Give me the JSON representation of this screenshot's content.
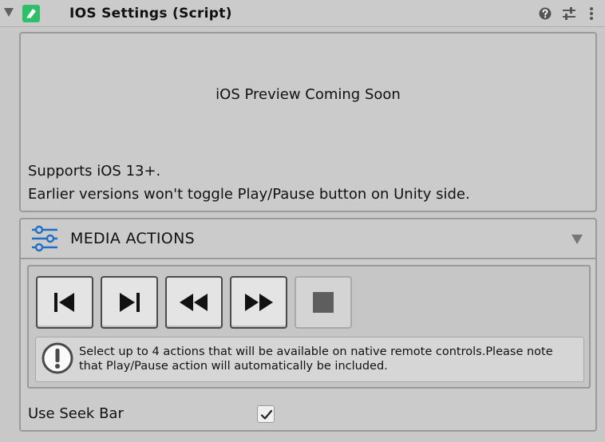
{
  "component": {
    "title": "IOS Settings (Script)",
    "icons": [
      "foldout-arrow-icon",
      "script-icon",
      "help-icon",
      "preset-icon",
      "kebab-menu-icon"
    ]
  },
  "preview": {
    "title": "iOS Preview Coming Soon",
    "support_text": "Supports iOS 13+.",
    "earlier_text": "Earlier versions won't toggle Play/Pause button on Unity side."
  },
  "media_actions": {
    "title": "MEDIA ACTIONS",
    "buttons": [
      {
        "name": "previous-track",
        "icon": "skip-previous-icon",
        "enabled": true
      },
      {
        "name": "next-track",
        "icon": "skip-next-icon",
        "enabled": true
      },
      {
        "name": "rewind",
        "icon": "rewind-icon",
        "enabled": true
      },
      {
        "name": "fast-forward",
        "icon": "fast-forward-icon",
        "enabled": true
      },
      {
        "name": "stop",
        "icon": "stop-icon",
        "enabled": false
      }
    ],
    "help_text": "Select up to 4 actions that will be available on native remote controls.Please note that Play/Pause action will automatically be included."
  },
  "seek_bar": {
    "label": "Use Seek Bar",
    "checked": true
  },
  "colors": {
    "background": "#c8c8c8",
    "accent_blue": "#1f6fc5",
    "script_icon_green": "#2fbf6a"
  }
}
